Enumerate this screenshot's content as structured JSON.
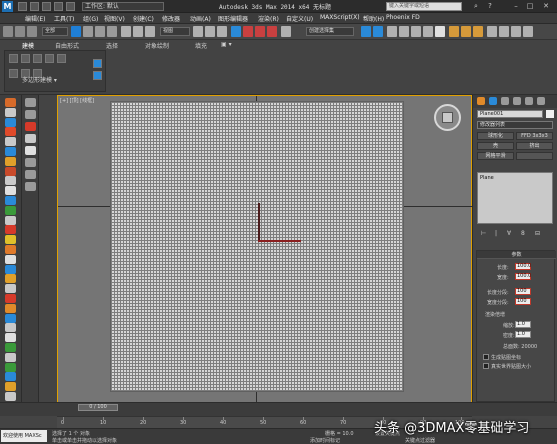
{
  "titlebar": {
    "workspace": "工作区: 默认",
    "title": "Autodesk 3ds Max  2014 x64    无标题",
    "search_placeholder": "键入关键字或短语"
  },
  "menu": [
    "编辑(E)",
    "工具(T)",
    "组(G)",
    "视图(V)",
    "创建(C)",
    "修改器",
    "动画(A)",
    "图形编辑器",
    "渲染(R)",
    "自定义(U)",
    "MAXScript(X)",
    "帮助(H)",
    "Phoenix FD"
  ],
  "maintoolbar": {
    "selection_filter": "全部",
    "coord_system": "视图",
    "named_selection": "创建选择集"
  },
  "ribbon": {
    "tabs": [
      "建模",
      "自由形式",
      "选择",
      "对象绘制",
      "填充"
    ],
    "panel_label": "多边形建模"
  },
  "viewport": {
    "label": "[+] [顶] [线框]"
  },
  "command_panel": {
    "object_name": "Plane001",
    "modifier_list": "修改器列表",
    "buttons": [
      "球形化",
      "FFD 3x3x3",
      "壳",
      "挤出",
      "网格平滑",
      ""
    ],
    "stack_item": "Plane",
    "rollout_title": "参数",
    "params": [
      {
        "label": "长度:",
        "value": "100.0"
      },
      {
        "label": "宽度:",
        "value": "100.0"
      }
    ],
    "segs": [
      {
        "label": "长度分段:",
        "value": "100"
      },
      {
        "label": "宽度分段:",
        "value": "100"
      }
    ],
    "render_mult_title": "渲染倍增",
    "render_mult": [
      {
        "label": "缩放:",
        "value": "1.0"
      },
      {
        "label": "密度:",
        "value": "1.0"
      }
    ],
    "total_faces": "总面数: 20000",
    "checkboxes": [
      "生成贴图坐标",
      "真实世界贴图大小"
    ]
  },
  "timeslider": {
    "frame": "0 / 100"
  },
  "trackbar": {
    "ticks": [
      "0",
      "10",
      "20",
      "30",
      "40",
      "50",
      "60",
      "70",
      "80",
      "90",
      "100"
    ]
  },
  "status": {
    "maxscript": "欢迎使用 MAXSc",
    "selected": "选择了 1 个 对象",
    "prompt": "单击或单击并拖动以选择对象",
    "grid": "栅格 = 10.0",
    "add_time_tag": "添加时间标记",
    "set_key": "设置关键点",
    "key_filter": "关键点过滤器"
  },
  "watermark": "头条 @3DMAX零基础学习",
  "colors": {
    "viewport_border": "#e0a000",
    "grid_plane": "#d6d6d6",
    "param_highlight": "#c0392b"
  }
}
